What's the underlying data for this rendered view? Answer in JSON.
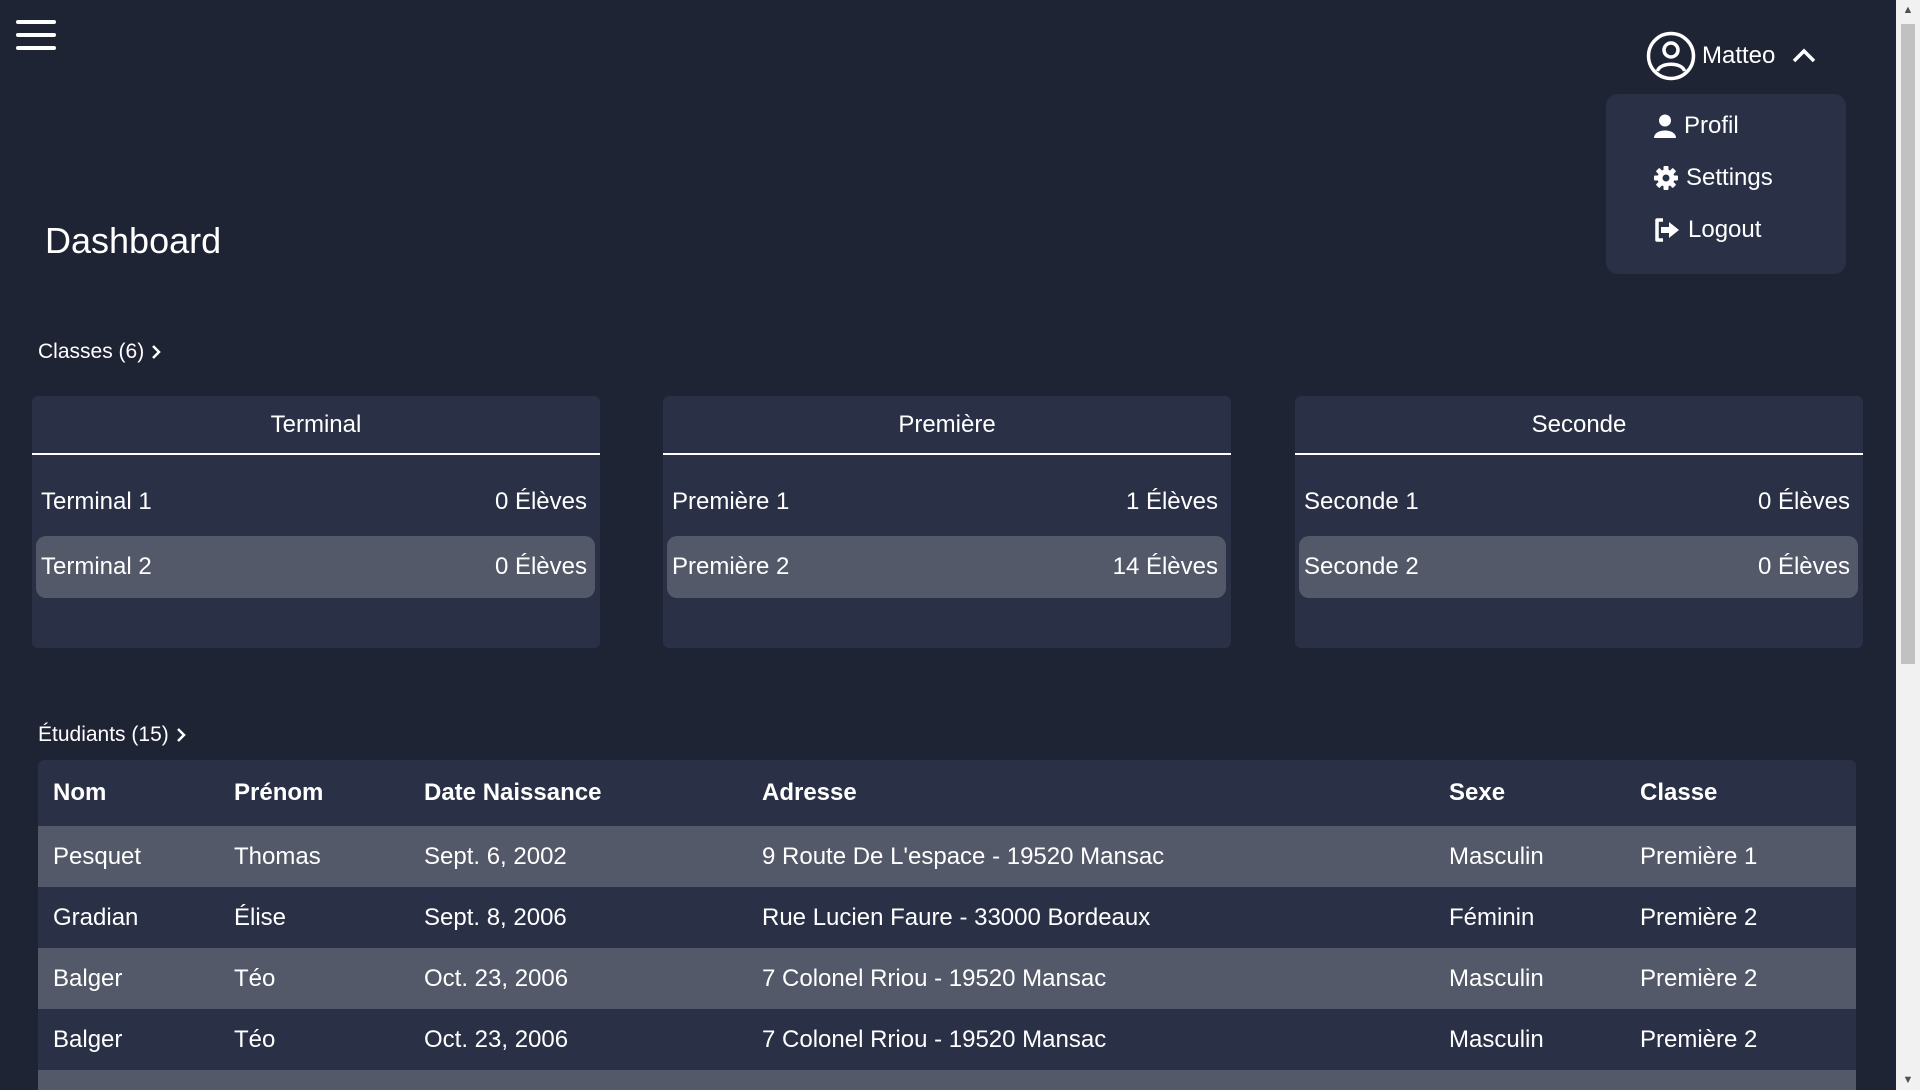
{
  "user": {
    "name": "Matteo"
  },
  "menu": {
    "items": [
      {
        "label": "Profil",
        "icon": "user-icon"
      },
      {
        "label": "Settings",
        "icon": "gear-icon"
      },
      {
        "label": "Logout",
        "icon": "logout-icon"
      }
    ]
  },
  "page": {
    "title": "Dashboard"
  },
  "classes": {
    "label": "Classes (6)",
    "groups": [
      {
        "title": "Terminal",
        "rows": [
          {
            "name": "Terminal 1",
            "count": "0 Élèves"
          },
          {
            "name": "Terminal 2",
            "count": "0 Élèves"
          }
        ]
      },
      {
        "title": "Première",
        "rows": [
          {
            "name": "Première 1",
            "count": "1 Élèves"
          },
          {
            "name": "Première 2",
            "count": "14 Élèves"
          }
        ]
      },
      {
        "title": "Seconde",
        "rows": [
          {
            "name": "Seconde 1",
            "count": "0 Élèves"
          },
          {
            "name": "Seconde 2",
            "count": "0 Élèves"
          }
        ]
      }
    ]
  },
  "students": {
    "label": "Étudiants (15)",
    "columns": [
      "Nom",
      "Prénom",
      "Date Naissance",
      "Adresse",
      "Sexe",
      "Classe"
    ],
    "rows": [
      [
        "Pesquet",
        "Thomas",
        "Sept. 6, 2002",
        "9 Route De L'espace - 19520 Mansac",
        "Masculin",
        "Première 1"
      ],
      [
        "Gradian",
        "Élise",
        "Sept. 8, 2006",
        "Rue Lucien Faure - 33000 Bordeaux",
        "Féminin",
        "Première 2"
      ],
      [
        "Balger",
        "Téo",
        "Oct. 23, 2006",
        "7 Colonel Rriou - 19520 Mansac",
        "Masculin",
        "Première 2"
      ],
      [
        "Balger",
        "Téo",
        "Oct. 23, 2006",
        "7 Colonel Rriou - 19520 Mansac",
        "Masculin",
        "Première 2"
      ]
    ]
  },
  "colors": {
    "background": "#1f2434",
    "card": "#2a3046",
    "row_highlight": "#535969",
    "text": "#ffffff"
  }
}
